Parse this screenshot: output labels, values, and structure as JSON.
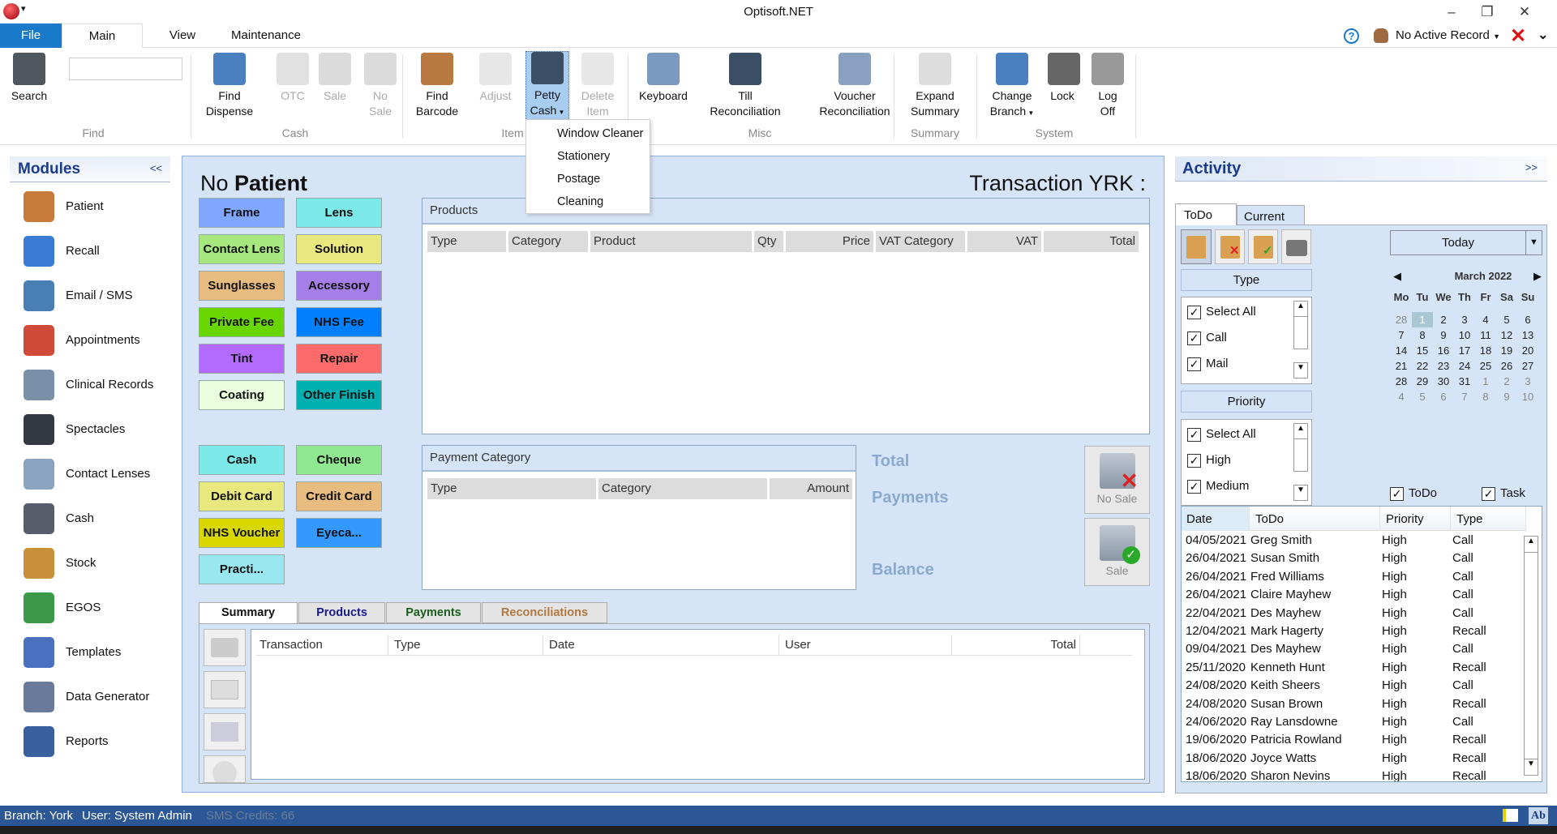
{
  "app": {
    "title": "Optisoft.NET"
  },
  "ribbon_tabs": [
    {
      "label": "File"
    },
    {
      "label": "Main"
    },
    {
      "label": "View"
    },
    {
      "label": "Maintenance"
    }
  ],
  "header_right": {
    "active_record": "No Active Record"
  },
  "ribbon": {
    "search_input": {
      "value": "",
      "placeholder": ""
    },
    "buttons": [
      {
        "label": "Search",
        "icon": "binoculars-icon",
        "enabled": true
      },
      {
        "label": "Find Dispense",
        "icon": "find-dispense-icon",
        "enabled": true
      },
      {
        "label": "OTC",
        "icon": "otc-icon",
        "enabled": false
      },
      {
        "label": "Sale",
        "icon": "till-sale-icon",
        "enabled": false
      },
      {
        "label": "No Sale",
        "icon": "till-no-sale-icon",
        "enabled": false
      },
      {
        "label": "Find Barcode",
        "icon": "barcode-box-icon",
        "enabled": true
      },
      {
        "label": "Adjust",
        "icon": "adjust-icon",
        "enabled": false
      },
      {
        "label": "Petty Cash",
        "icon": "petty-cash-icon",
        "enabled": true,
        "dropdown": true,
        "active": true
      },
      {
        "label": "Delete Item",
        "icon": "delete-basket-icon",
        "enabled": false
      },
      {
        "label": "Keyboard",
        "icon": "keyboard-icon",
        "enabled": true
      },
      {
        "label": "Till Reconciliation",
        "icon": "till-check-icon",
        "enabled": true
      },
      {
        "label": "Voucher Reconciliation",
        "icon": "voucher-paid-icon",
        "enabled": true
      },
      {
        "label": "Expand Summary",
        "icon": "expand-summary-icon",
        "enabled": true
      },
      {
        "label": "Change Branch",
        "icon": "change-branch-icon",
        "enabled": true,
        "dropdown": true
      },
      {
        "label": "Lock",
        "icon": "padlock-icon",
        "enabled": true
      },
      {
        "label": "Log Off",
        "icon": "key-logoff-icon",
        "enabled": true
      }
    ],
    "groups": [
      {
        "label": "Find"
      },
      {
        "label": "Cash"
      },
      {
        "label": "Item"
      },
      {
        "label": "Misc"
      },
      {
        "label": "Summary"
      },
      {
        "label": "System"
      }
    ]
  },
  "petty_cash_menu": [
    {
      "label": "Window Cleaner"
    },
    {
      "label": "Stationery"
    },
    {
      "label": "Postage"
    },
    {
      "label": "Cleaning"
    }
  ],
  "modules": {
    "title": "Modules",
    "collapse": "<<",
    "items": [
      {
        "label": "Patient",
        "color": "#c77a3a"
      },
      {
        "label": "Recall",
        "color": "#3a7bd5"
      },
      {
        "label": "Email / SMS",
        "color": "#4a7fb5"
      },
      {
        "label": "Appointments",
        "color": "#d04a3a"
      },
      {
        "label": "Clinical Records",
        "color": "#7a8fa8"
      },
      {
        "label": "Spectacles",
        "color": "#333a44"
      },
      {
        "label": "Contact Lenses",
        "color": "#8aa4c0"
      },
      {
        "label": "Cash",
        "color": "#555e6a"
      },
      {
        "label": "Stock",
        "color": "#c8903a"
      },
      {
        "label": "EGOS",
        "color": "#3a9a4a"
      },
      {
        "label": "Templates",
        "color": "#4a70c0"
      },
      {
        "label": "Data Generator",
        "color": "#6a7a9a"
      },
      {
        "label": "Reports",
        "color": "#3a60a0"
      }
    ]
  },
  "center": {
    "patient_prefix": "No",
    "patient_label": "Patient",
    "transaction": "Transaction YRK :",
    "product_buttons": [
      {
        "label": "Frame",
        "color": "#7fa7ff"
      },
      {
        "label": "Lens",
        "color": "#7de8e8"
      },
      {
        "label": "Contact Lens",
        "color": "#a6e87e"
      },
      {
        "label": "Solution",
        "color": "#e8e87e"
      },
      {
        "label": "Sunglasses",
        "color": "#e8bb7e"
      },
      {
        "label": "Accessory",
        "color": "#a67ee8"
      },
      {
        "label": "Private Fee",
        "color": "#6ad600"
      },
      {
        "label": "NHS Fee",
        "color": "#0080ff"
      },
      {
        "label": "Tint",
        "color": "#b36bff"
      },
      {
        "label": "Repair",
        "color": "#ff6b6b"
      },
      {
        "label": "Coating",
        "color": "#eaffdd"
      },
      {
        "label": "Other Finish",
        "color": "#00b0b0"
      }
    ],
    "payment_buttons": [
      {
        "label": "Cash",
        "color": "#7de8e8"
      },
      {
        "label": "Cheque",
        "color": "#90e890"
      },
      {
        "label": "Debit Card",
        "color": "#e8e87e"
      },
      {
        "label": "Credit Card",
        "color": "#e8bb7e"
      },
      {
        "label": "NHS Voucher",
        "color": "#d8d800"
      },
      {
        "label": "Eyeca...",
        "color": "#3399ff"
      },
      {
        "label": "Practi...",
        "color": "#99e8f0"
      }
    ],
    "products": {
      "title": "Products",
      "columns": [
        "Type",
        "Category",
        "Product",
        "Qty",
        "Price",
        "VAT Category",
        "VAT",
        "Total"
      ],
      "rows": []
    },
    "payments": {
      "title": "Payment Category",
      "columns": [
        "Type",
        "Category",
        "Amount"
      ],
      "rows": []
    },
    "totals": {
      "total_label": "Total",
      "payments_label": "Payments",
      "balance_label": "Balance"
    },
    "no_sale_label": "No Sale",
    "sale_label": "Sale",
    "summary_tabs": [
      {
        "label": "Summary",
        "color": "#111"
      },
      {
        "label": "Products",
        "color": "#1a1a8c"
      },
      {
        "label": "Payments",
        "color": "#1a5e1a"
      },
      {
        "label": "Reconciliations",
        "color": "#b07840"
      }
    ],
    "summary_grid": {
      "columns": [
        "Transaction",
        "Type",
        "Date",
        "User",
        "Total"
      ],
      "rows": []
    }
  },
  "activity": {
    "title": "Activity",
    "expand": ">>",
    "tabs": [
      {
        "label": "ToDo"
      },
      {
        "label": "Current"
      }
    ],
    "type_header": "Type",
    "type_items": [
      {
        "label": "Select All",
        "checked": true
      },
      {
        "label": "Call",
        "checked": true
      },
      {
        "label": "Mail",
        "checked": true
      }
    ],
    "priority_header": "Priority",
    "priority_items": [
      {
        "label": "Select All",
        "checked": true
      },
      {
        "label": "High",
        "checked": true
      },
      {
        "label": "Medium",
        "checked": true
      }
    ],
    "today_label": "Today",
    "calendar": {
      "month": "March 2022",
      "days": [
        "Mo",
        "Tu",
        "We",
        "Th",
        "Fr",
        "Sa",
        "Su"
      ],
      "selected": 1,
      "weeks": [
        [
          28,
          1,
          2,
          3,
          4,
          5,
          6
        ],
        [
          7,
          8,
          9,
          10,
          11,
          12,
          13
        ],
        [
          14,
          15,
          16,
          17,
          18,
          19,
          20
        ],
        [
          21,
          22,
          23,
          24,
          25,
          26,
          27
        ],
        [
          28,
          29,
          30,
          31,
          1,
          2,
          3
        ],
        [
          4,
          5,
          6,
          7,
          8,
          9,
          10
        ]
      ]
    },
    "show_todo": {
      "label": "ToDo",
      "checked": true
    },
    "show_task": {
      "label": "Task",
      "checked": true
    },
    "grid": {
      "columns": [
        "Date",
        "ToDo",
        "Priority",
        "Type"
      ],
      "rows": [
        [
          "04/05/2021",
          "Greg Smith",
          "High",
          "Call"
        ],
        [
          "26/04/2021",
          "Susan Smith",
          "High",
          "Call"
        ],
        [
          "26/04/2021",
          "Fred Williams",
          "High",
          "Call"
        ],
        [
          "26/04/2021",
          "Claire Mayhew",
          "High",
          "Call"
        ],
        [
          "22/04/2021",
          "Des Mayhew",
          "High",
          "Call"
        ],
        [
          "12/04/2021",
          "Mark Hagerty",
          "High",
          "Recall"
        ],
        [
          "09/04/2021",
          "Des Mayhew",
          "High",
          "Call"
        ],
        [
          "25/11/2020",
          "Kenneth Hunt",
          "High",
          "Recall"
        ],
        [
          "24/08/2020",
          "Keith Sheers",
          "High",
          "Call"
        ],
        [
          "24/08/2020",
          "Susan Brown",
          "High",
          "Recall"
        ],
        [
          "24/06/2020",
          "Ray Lansdowne",
          "High",
          "Call"
        ],
        [
          "19/06/2020",
          "Patricia Rowland",
          "High",
          "Recall"
        ],
        [
          "18/06/2020",
          "Joyce Watts",
          "High",
          "Recall"
        ],
        [
          "18/06/2020",
          "Sharon Nevins",
          "High",
          "Recall"
        ]
      ]
    }
  },
  "status": {
    "branch": "Branch: York",
    "user": "User: System Admin",
    "sms": "SMS Credits: 66"
  },
  "colors": {
    "file_tab": "#1979ca",
    "status_bar": "#2c5797",
    "panel": "#d6e4f7",
    "heading": "#1b3c8c"
  }
}
